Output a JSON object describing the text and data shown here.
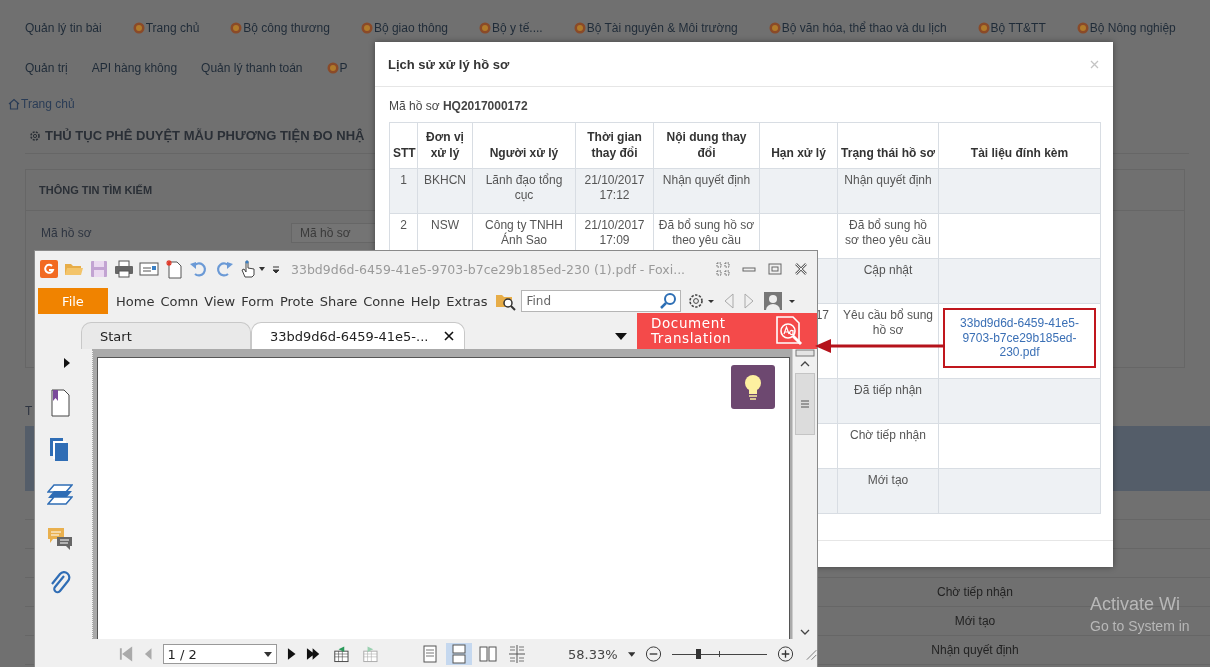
{
  "nav": {
    "rows": [
      [
        {
          "label": "Quản lý tin bài",
          "kind": "plain"
        },
        {
          "label": "Trang chủ",
          "kind": "emblem"
        },
        {
          "label": "Bộ công thương",
          "kind": "emblem"
        },
        {
          "label": "Bộ giao thông",
          "kind": "emblem"
        },
        {
          "label": "Bộ y tế....",
          "kind": "emblem"
        },
        {
          "label": "Bộ Tài nguyên & Môi trường",
          "kind": "emblem"
        },
        {
          "label": "Bộ văn hóa, thể thao và du lịch",
          "kind": "emblem"
        },
        {
          "label": "Bộ TT&TT",
          "kind": "emblem"
        },
        {
          "label": "Bộ Nông nghiệp",
          "kind": "emblem"
        }
      ],
      [
        {
          "label": "Quản trị",
          "kind": "plain"
        },
        {
          "label": "API hàng không",
          "kind": "plain"
        },
        {
          "label": "Quản lý thanh toán",
          "kind": "plain"
        },
        {
          "label": "P",
          "kind": "emblem"
        }
      ]
    ]
  },
  "breadcrumb": "Trang chủ",
  "page_title": "THỦ TỤC PHÊ DUYỆT MẪU PHƯƠNG TIỆN ĐO NHẬ",
  "search_panel": {
    "title": "THÔNG TIN TÌM KIẾM",
    "field_label": "Mã hồ sơ",
    "placeholder": "Mã hồ sơ"
  },
  "section_title": "T",
  "result_rows": [
    "Chờ tiếp nhận",
    "Mới tạo",
    "Nhận quyết định"
  ],
  "dialog": {
    "title": "Lịch sử xử lý hồ sơ",
    "code_label": "Mã hồ sơ",
    "code": "HQ2017000172",
    "columns": [
      "STT",
      "Đơn vị xử lý",
      "Người xử lý",
      "Thời gian thay đổi",
      "Nội dung thay đổi",
      "Hạn xử lý",
      "Trạng thái hồ sơ",
      "Tài liệu đính kèm"
    ],
    "rows": [
      {
        "stt": "1",
        "unit": "BKHCN",
        "handler": "Lãnh đạo tổng cục",
        "time": "21/10/2017 17:12",
        "content": "Nhận quyết định",
        "status": "Nhận quyết định"
      },
      {
        "stt": "2",
        "unit": "NSW",
        "handler": "Công ty TNHH Ánh Sao",
        "time": "21/10/2017 17:09",
        "content": "Đã bổ sung hồ sơ theo yêu cầu",
        "status": "Đã bổ sung hồ sơ theo yêu cầu"
      },
      {
        "status": "Cập nhật"
      },
      {
        "deadline": "17",
        "status": "Yêu cầu bổ sung hồ sơ",
        "attachment": {
          "text": "33bd9d6d-6459-41e5-9703-b7ce29b185ed-230.pdf",
          "marked": true
        }
      },
      {
        "status": "Đã tiếp nhận"
      },
      {
        "status": "Chờ tiếp nhận"
      },
      {
        "status": "Mới tạo"
      }
    ]
  },
  "pdf_window": {
    "title": "33bd9d6d-6459-41e5-9703-b7ce29b185ed-230 (1).pdf - Foxi...",
    "file_menu": "File",
    "ribbon_tabs": [
      "Home",
      "Comn",
      "View",
      "Form",
      "Prote",
      "Share",
      "Conne",
      "Help",
      "Extras"
    ],
    "find_placeholder": "Find",
    "doc_tabs": [
      {
        "label": "Start",
        "selected": false,
        "closable": false
      },
      {
        "label": "33bd9d6d-6459-41e5-...",
        "selected": true,
        "closable": true
      }
    ],
    "translation_banner": "Document Translation",
    "page_field": "1 / 2",
    "view_modes": [
      {
        "kind": "single",
        "selected": false
      },
      {
        "kind": "continuous",
        "selected": true
      },
      {
        "kind": "facing",
        "selected": false
      },
      {
        "kind": "split",
        "selected": false
      }
    ],
    "zoom": "58.33%",
    "zoom_slider": {
      "level": 0.27
    }
  },
  "os_notice": [
    "Activate Wi",
    "Go to System in"
  ]
}
